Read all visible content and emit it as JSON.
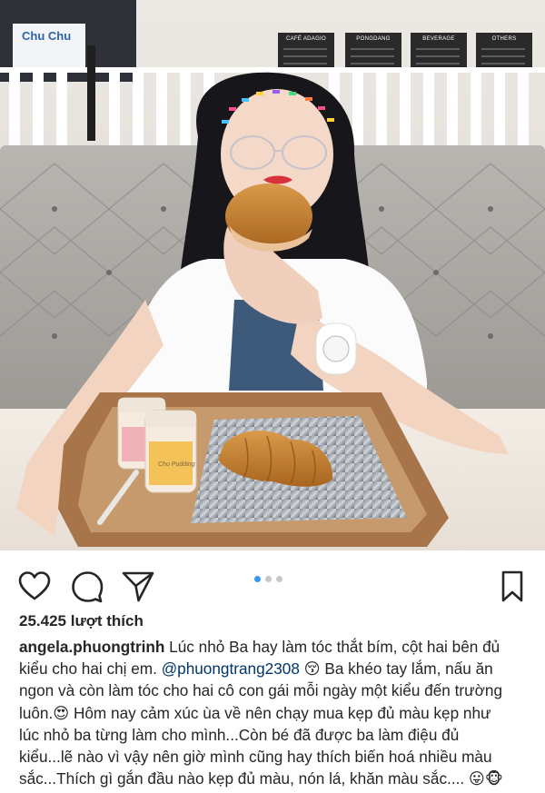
{
  "photo": {
    "cafe_sign": "Chu Chu",
    "menu_boards": [
      "CAFÉ ADAGIO",
      "PONGDANG",
      "BEVERAGE",
      "OTHERS"
    ],
    "jar_label": "Chu Pudding",
    "alt": "Cô gái đeo kính cắn bánh tại quán cà phê"
  },
  "actions": {
    "icons": [
      "heart-icon",
      "comment-icon",
      "share-icon",
      "bookmark-icon"
    ],
    "carousel_pages": 3,
    "carousel_active": 1
  },
  "likes": "25.425 lượt thích",
  "caption": {
    "username": "angela.phuongtrinh",
    "text_1": " Lúc nhỏ Ba hay làm tóc thắt bím, cột hai bên đủ kiểu cho hai chị em. ",
    "mention": "@phuongtrang2308",
    "text_2": " 😚 Ba khéo tay lắm, nấu ăn ngon và còn làm tóc cho hai cô con gái mỗi ngày một kiểu đến trường luôn.😍 Hôm nay cảm xúc ùa về nên chạy mua kẹp đủ màu kẹp như lúc nhỏ ba từng làm cho mình...Còn bé đã được ba làm điệu đủ kiểu...lẽ nào vì vậy nên giờ mình cũng hay thích biến hoá nhiều màu sắc...Thích gì gắn đầu nào kẹp đủ màu, nón lá, khăn màu sắc.... 😛🐵"
  },
  "colors": {
    "accent": "#3897f0",
    "mention": "#003569",
    "text": "#262626",
    "dot_inactive": "#c7c7c7"
  }
}
